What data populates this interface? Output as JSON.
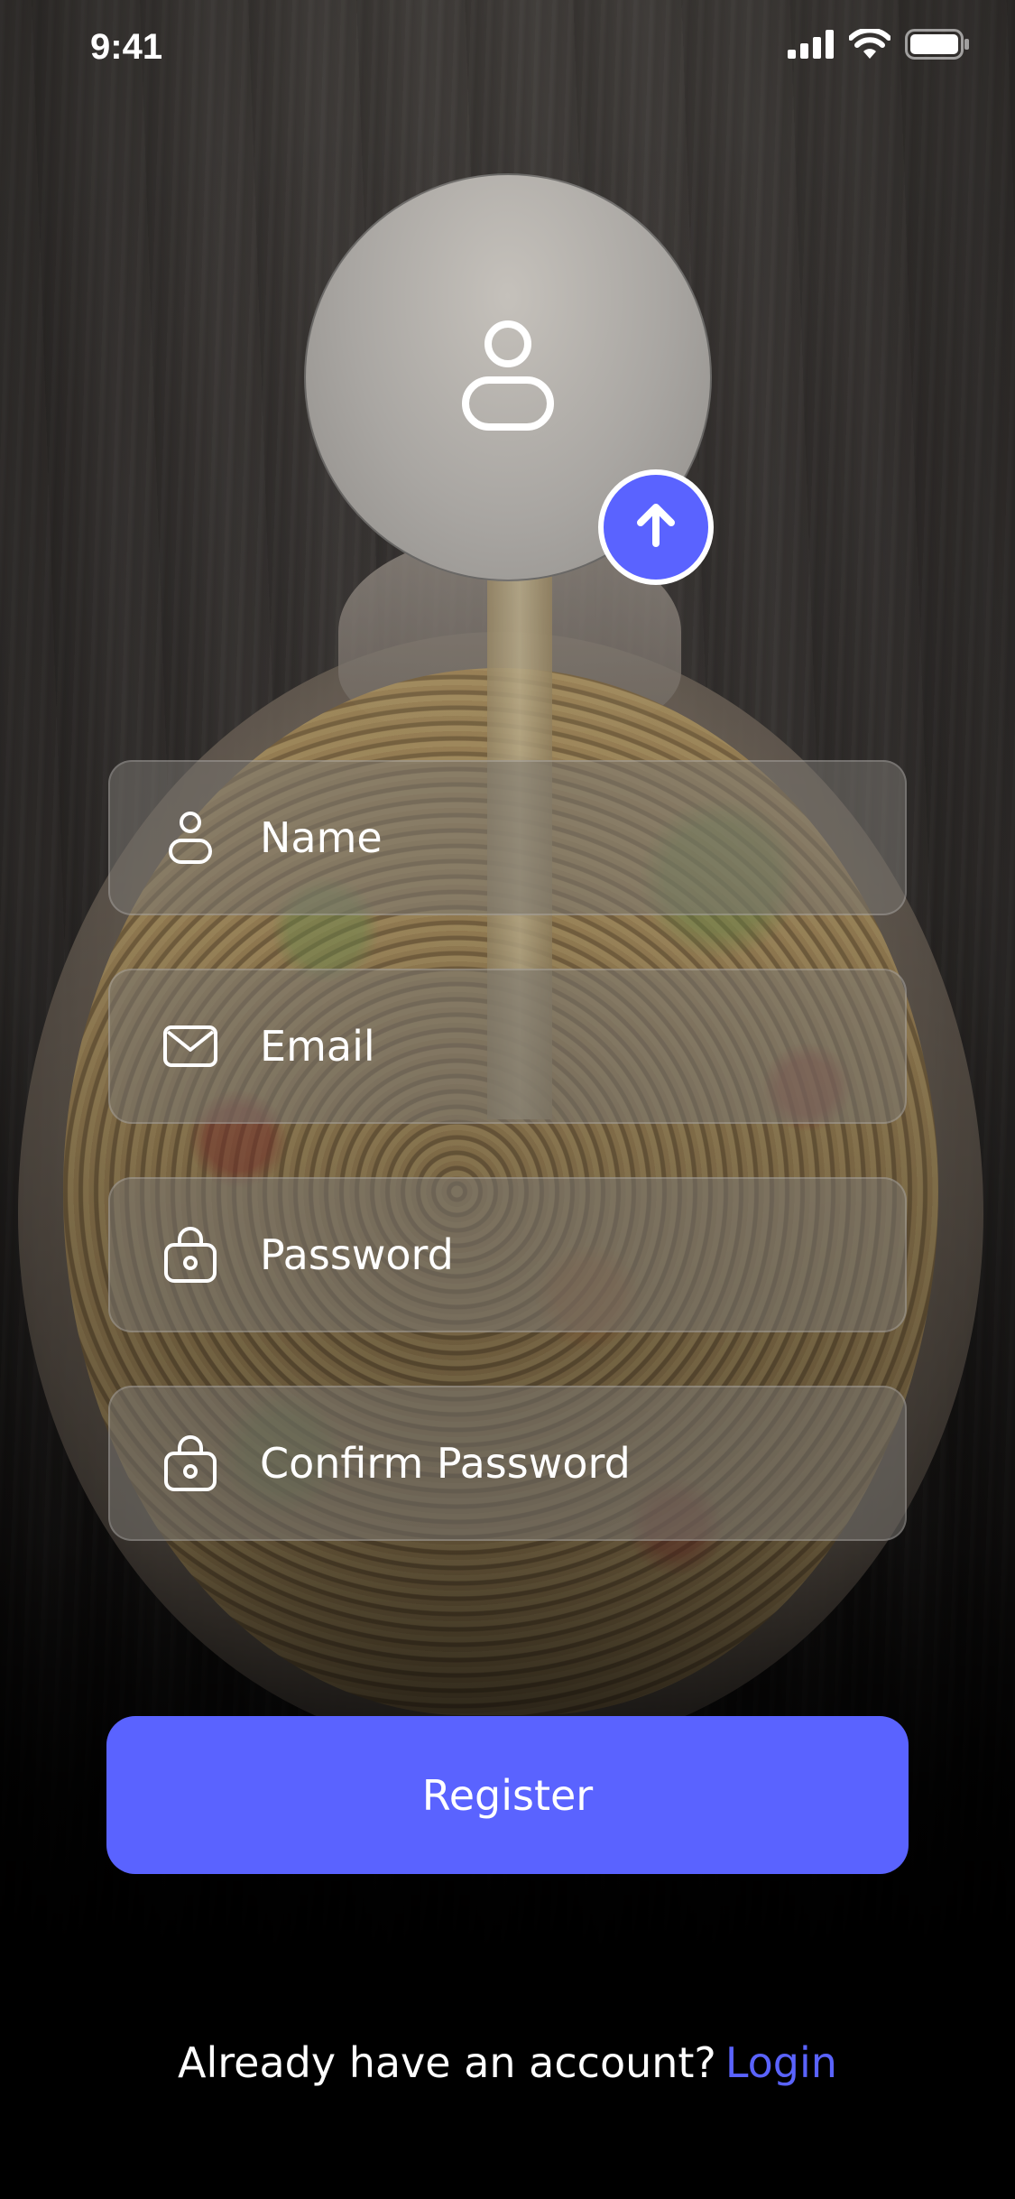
{
  "status_bar": {
    "time": "9:41",
    "icons": [
      "cellular-signal-icon",
      "wifi-icon",
      "battery-icon"
    ]
  },
  "avatar": {
    "icon": "user-icon",
    "upload_icon": "arrow-up-icon"
  },
  "form": {
    "name": {
      "placeholder": "Name",
      "value": "",
      "icon": "user-icon"
    },
    "email": {
      "placeholder": "Email",
      "value": "",
      "icon": "mail-icon"
    },
    "password": {
      "placeholder": "Password",
      "value": "",
      "icon": "lock-icon"
    },
    "confirm_password": {
      "placeholder": "Confirm Password",
      "value": "",
      "icon": "lock-icon"
    }
  },
  "register_button": {
    "label": "Register"
  },
  "footer": {
    "prompt": "Already have an account?",
    "link_label": "Login"
  },
  "colors": {
    "accent": "#5a63ff",
    "text": "#ffffff"
  }
}
